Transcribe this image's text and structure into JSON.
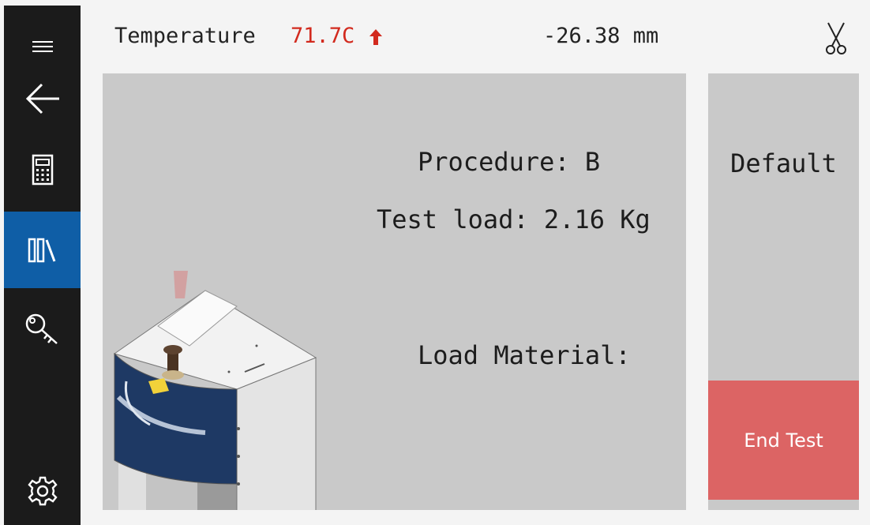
{
  "sidebar": {
    "items": [
      {
        "name": "menu",
        "icon": "hamburger-menu-icon"
      },
      {
        "name": "back",
        "icon": "arrow-left-icon"
      },
      {
        "name": "calculator",
        "icon": "calculator-icon"
      },
      {
        "name": "library",
        "icon": "library-books-icon",
        "active": true
      },
      {
        "name": "key",
        "icon": "key-icon"
      },
      {
        "name": "settings",
        "icon": "gear-icon"
      }
    ],
    "active_color": "#0f5ea6"
  },
  "header": {
    "temperature_label": "Temperature",
    "temperature_value": "71.7C",
    "temperature_trend_icon": "arrow-up-icon",
    "temperature_color": "#d22a1e",
    "position_value": "-26.38 mm",
    "tool_icon": "scissors-icon"
  },
  "main": {
    "procedure": "Procedure: B",
    "test_load": "Test load: 2.16 Kg",
    "load_material": "Load Material:",
    "machine_image": "melt-flow-indexer-icon"
  },
  "right_panel": {
    "default_label": "Default",
    "end_test_label": "End Test",
    "end_test_color": "#dc6464"
  }
}
